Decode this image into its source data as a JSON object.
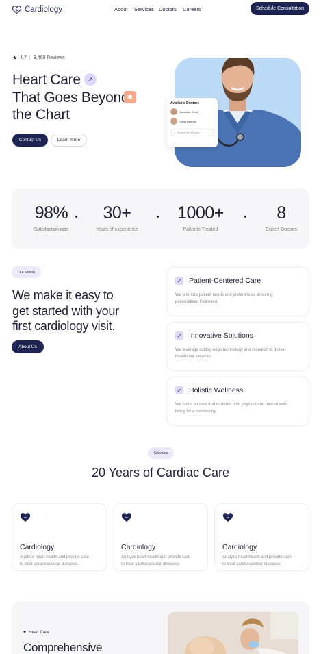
{
  "brand": {
    "name": "Cardiology",
    "accent": "#1e2452",
    "soft": "#ddd8fb",
    "peach": "#f3a88a"
  },
  "nav": {
    "items": [
      "About",
      "Services",
      "Doctors",
      "Careers"
    ],
    "cta": "Schedule Consultation"
  },
  "hero": {
    "rating": "4.7",
    "reviews": "3,460 Reviews",
    "title_l1": "Heart Care",
    "title_l2": "That Goes Beyond",
    "title_l3": "the Chart",
    "primary_btn": "Contact Us",
    "secondary_btn": "Learn more",
    "card": {
      "title": "Available Doctors",
      "doctors": [
        {
          "name": "Jonathan Reed"
        },
        {
          "name": "Olivia Bennett"
        }
      ],
      "search_placeholder": "Search for a Doctor"
    }
  },
  "stats": [
    {
      "value": "98%",
      "label": "Satisfaction rate"
    },
    {
      "value": "30+",
      "label": "Years of experience"
    },
    {
      "value": "1000+",
      "label": "Patients Treated"
    },
    {
      "value": "8",
      "label": "Expert Doctors"
    }
  ],
  "vision": {
    "tag": "Our Vision",
    "title_l1": "We make it easy to",
    "title_l2": "get started with your",
    "title_l3": "first cardiology visit.",
    "button": "About Us",
    "cards": [
      {
        "title": "Patient-Centered Care",
        "desc_l1": "We prioritize patient needs and preferences, ensuring",
        "desc_l2": "personalized treatment."
      },
      {
        "title": "Innovative Solutions",
        "desc_l1": "We leverage cutting-edge technology and research to deliver",
        "desc_l2": "healthcare services."
      },
      {
        "title": "Holistic Wellness",
        "desc_l1": "We focus on care that nurtures both physical and mental well-",
        "desc_l2": "being for a community."
      }
    ]
  },
  "services": {
    "tag": "Services",
    "title": "20 Years of Cardiac Care",
    "items": [
      {
        "title": "Cardiology",
        "desc_l1": "Analyze heart health and provide care",
        "desc_l2": "to treat cardiovascular diseases."
      },
      {
        "title": "Cardiology",
        "desc_l1": "Analyze heart health and provide care",
        "desc_l2": "to treat cardiovascular diseases."
      },
      {
        "title": "Cardiology",
        "desc_l1": "Analyze heart health and provide care",
        "desc_l2": "to treat cardiovascular diseases."
      }
    ]
  },
  "bottom": {
    "tag": "Heart Care",
    "title": "Comprehensive"
  }
}
